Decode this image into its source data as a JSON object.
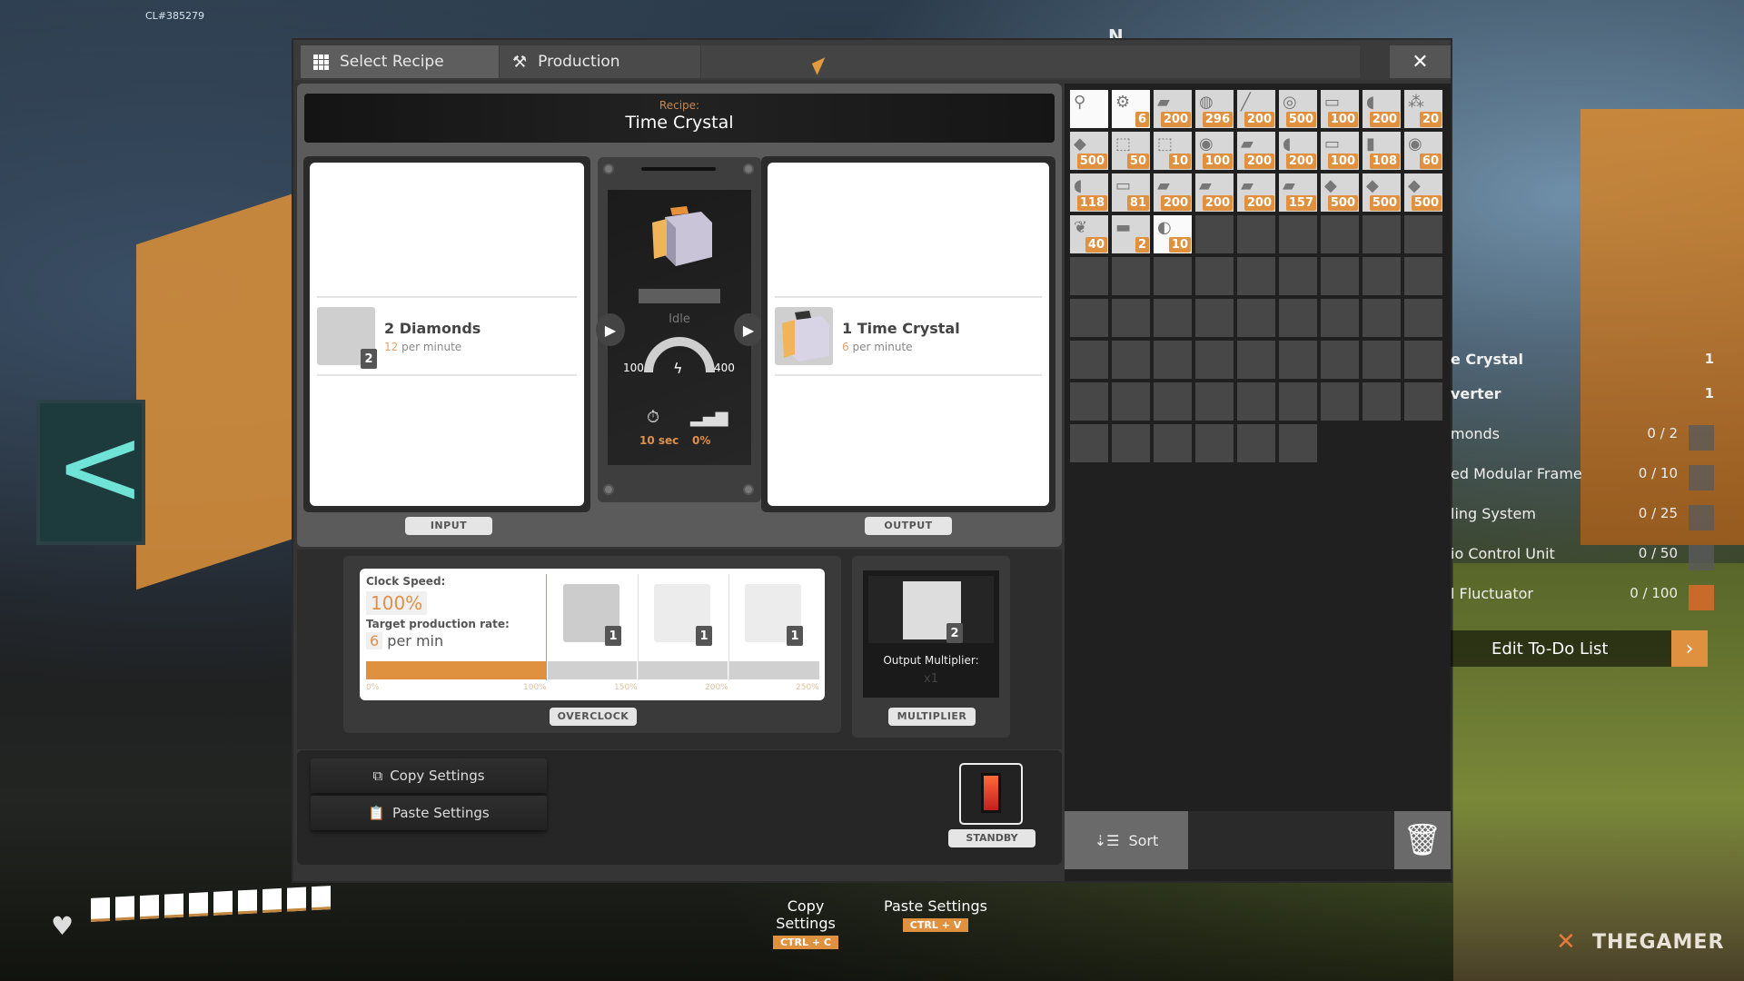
{
  "hud": {
    "build_id": "CL#385279",
    "compass": "N",
    "health_segments": 10,
    "health_filled": 10,
    "hints": [
      {
        "label": "Copy Settings",
        "key": "CTRL + C"
      },
      {
        "label": "Paste Settings",
        "key": "CTRL + V"
      }
    ],
    "watermark": "THEGAMER"
  },
  "window": {
    "tabs": [
      {
        "label": "Select Recipe",
        "icon": "grid-icon",
        "active": true
      },
      {
        "label": "Production",
        "icon": "hammer-icon",
        "active": false
      }
    ],
    "close_icon": "✕"
  },
  "recipe": {
    "label": "Recipe:",
    "name": "Time Crystal"
  },
  "input": {
    "section_label": "INPUT",
    "item": {
      "name": "2 Diamonds",
      "rate_value": "12",
      "rate_unit": "per minute",
      "badge": "2"
    }
  },
  "output": {
    "section_label": "OUTPUT",
    "item": {
      "name": "1 Time Crystal",
      "rate_value": "6",
      "rate_unit": "per minute"
    }
  },
  "machine": {
    "status": "Idle",
    "power_min": "100",
    "power_max": "400",
    "cycle_time": "10 sec",
    "productivity": "0%",
    "progress": 0
  },
  "overclock": {
    "clock_label": "Clock Speed:",
    "clock_value": "100%",
    "rate_label": "Target production rate:",
    "rate_value": "6",
    "rate_unit": "per min",
    "fill_percent": 100,
    "ticks": [
      "0%",
      "100%",
      "150%",
      "200%",
      "250%"
    ],
    "shard_slots": [
      {
        "badge": "1"
      },
      {
        "badge": "1"
      },
      {
        "badge": "1"
      }
    ],
    "section_label": "OVERCLOCK"
  },
  "multiplier": {
    "title": "Output Multiplier:",
    "value": "x1",
    "slot_badge": "2",
    "section_label": "MULTIPLIER"
  },
  "settings": {
    "copy_label": "Copy Settings",
    "paste_label": "Paste Settings"
  },
  "standby": {
    "label": "STANDBY",
    "state": "off"
  },
  "inventory": {
    "total_slots": 78,
    "items": [
      {
        "name": "tool",
        "count": "",
        "white": true
      },
      {
        "name": "equipment",
        "count": "6",
        "white": true
      },
      {
        "name": "plate",
        "count": "200"
      },
      {
        "name": "ore",
        "count": "296"
      },
      {
        "name": "rod",
        "count": "200"
      },
      {
        "name": "wire-spool",
        "count": "500"
      },
      {
        "name": "sheet",
        "count": "100"
      },
      {
        "name": "pipe",
        "count": "200"
      },
      {
        "name": "rocks",
        "count": "20"
      },
      {
        "name": "blue-crystals",
        "count": "500"
      },
      {
        "name": "frame",
        "count": "50"
      },
      {
        "name": "frame",
        "count": "10"
      },
      {
        "name": "motor",
        "count": "100"
      },
      {
        "name": "plate",
        "count": "200"
      },
      {
        "name": "pipe",
        "count": "200"
      },
      {
        "name": "sheet",
        "count": "100"
      },
      {
        "name": "wood",
        "count": "108"
      },
      {
        "name": "motor",
        "count": "60"
      },
      {
        "name": "pipe",
        "count": "118"
      },
      {
        "name": "sheet",
        "count": "81"
      },
      {
        "name": "plate",
        "count": "200"
      },
      {
        "name": "plate",
        "count": "200"
      },
      {
        "name": "plate",
        "count": "200"
      },
      {
        "name": "plate",
        "count": "157"
      },
      {
        "name": "blue-crystals",
        "count": "500"
      },
      {
        "name": "blue-crystals",
        "count": "500"
      },
      {
        "name": "blue-crystals",
        "count": "500"
      },
      {
        "name": "leaves",
        "count": "40"
      },
      {
        "name": "ingots",
        "count": "2"
      },
      {
        "name": "bolts",
        "count": "10",
        "white": true
      }
    ],
    "sort_label": "Sort"
  },
  "todo": {
    "rows": [
      {
        "label": "e Crystal",
        "count": "1",
        "header": true
      },
      {
        "label": "verter",
        "count": "1",
        "header": true
      },
      {
        "label": "monds",
        "count": "0 / 2"
      },
      {
        "label": "ed Modular Frame",
        "count": "0 / 10"
      },
      {
        "label": "ling System",
        "count": "0 / 25"
      },
      {
        "label": "io Control Unit",
        "count": "0 / 50"
      },
      {
        "label": "l Fluctuator",
        "count": "0 / 100"
      }
    ],
    "edit_label": "Edit To-Do List"
  }
}
